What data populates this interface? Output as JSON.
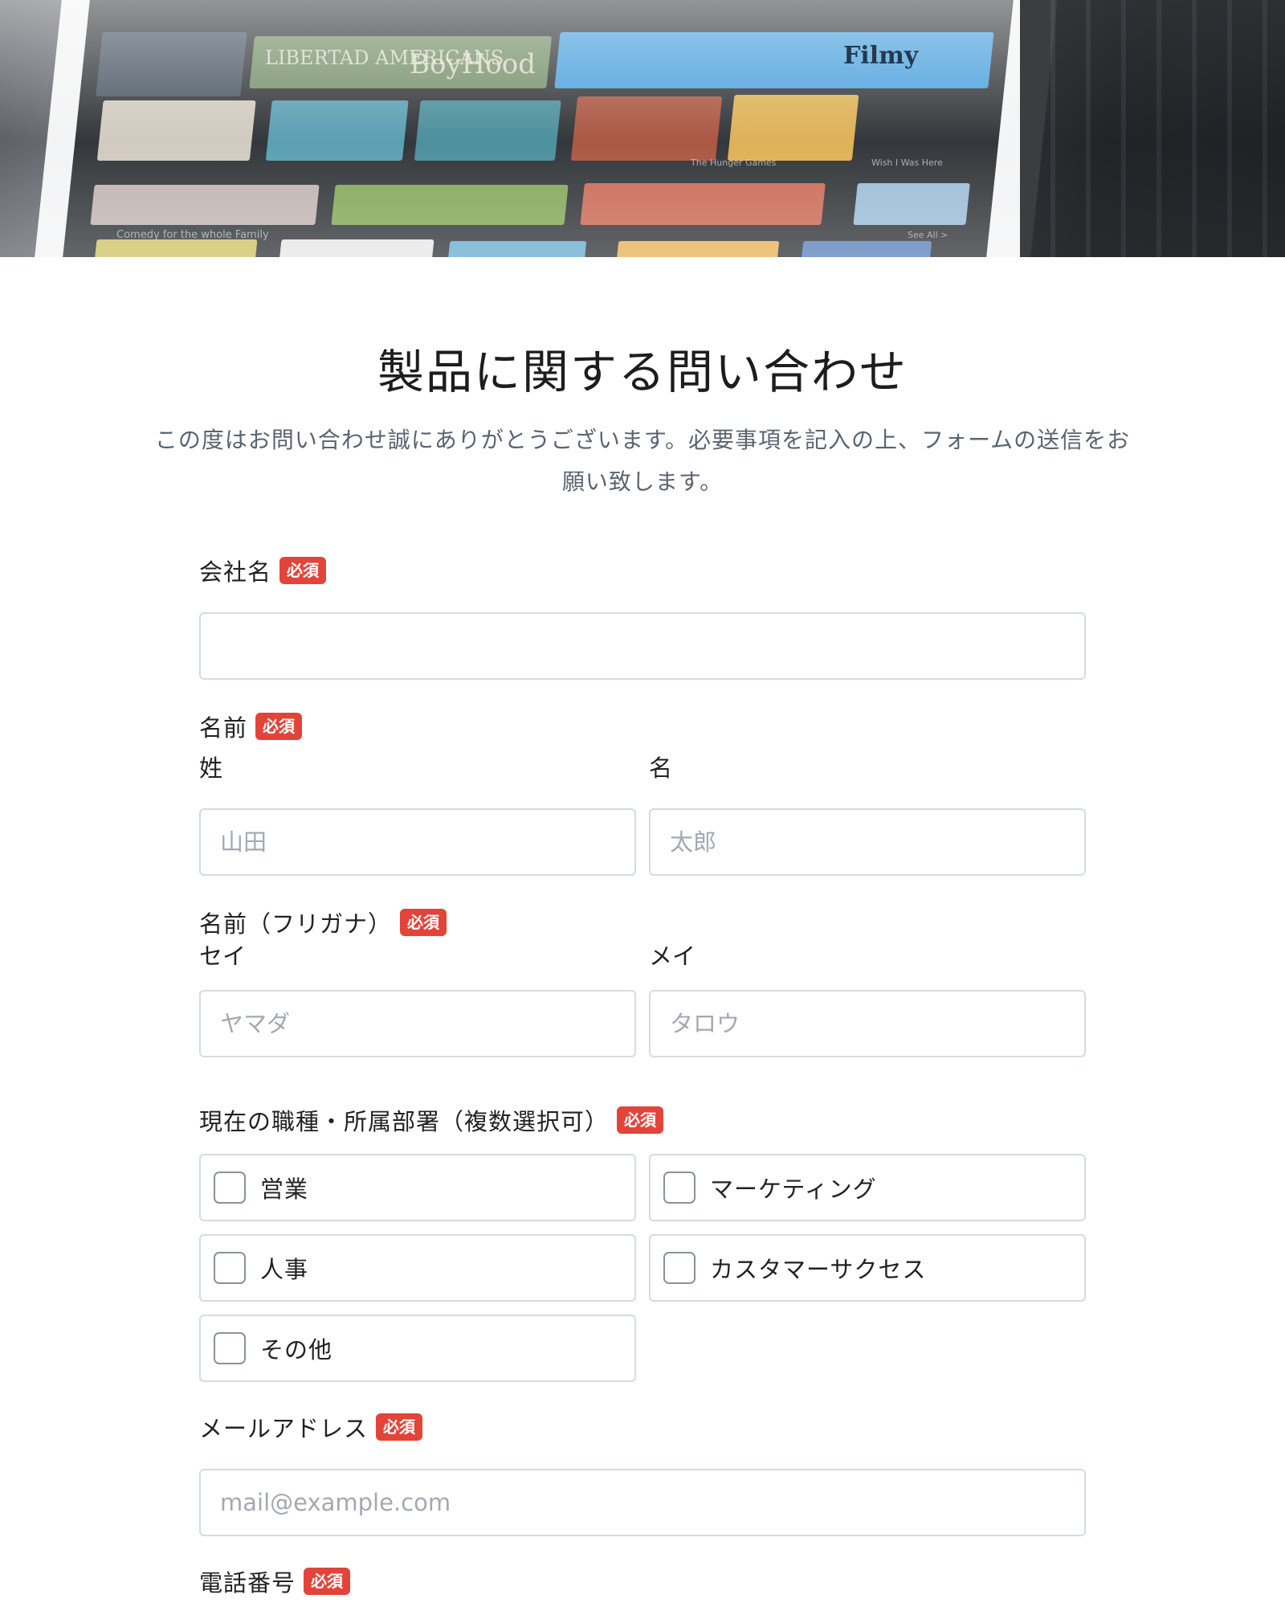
{
  "hero": {
    "banner_left": "LIBERTAD\nAMERICANS",
    "banner_mid": "BoyHood",
    "banner_right": "Filmy",
    "caption_1": "Comedy for the whole Family",
    "caption_2": "The Hunger Games",
    "caption_3": "Wish I Was Here",
    "caption_4": "See All >"
  },
  "page": {
    "title": "製品に関する問い合わせ",
    "description": "この度はお問い合わせ誠にありがとうございます。必要事項を記入の上、フォームの送信をお願い致します。"
  },
  "form": {
    "required_badge": "必須",
    "company": {
      "label": "会社名",
      "placeholder": ""
    },
    "name": {
      "label": "名前",
      "last_label": "姓",
      "last_placeholder": "山田",
      "first_label": "名",
      "first_placeholder": "太郎"
    },
    "kana": {
      "label": "名前（フリガナ）",
      "last_label": "セイ",
      "last_placeholder": "ヤマダ",
      "first_label": "メイ",
      "first_placeholder": "タロウ"
    },
    "role": {
      "label": "現在の職種・所属部署（複数選択可）",
      "options": [
        "営業",
        "マーケティング",
        "人事",
        "カスタマーサクセス",
        "その他"
      ]
    },
    "email": {
      "label": "メールアドレス",
      "placeholder": "mail@example.com"
    },
    "phone": {
      "label": "電話番号"
    }
  },
  "colors": {
    "badge": "#e2443a",
    "border": "#d7dbe0",
    "description": "#5b6470"
  }
}
